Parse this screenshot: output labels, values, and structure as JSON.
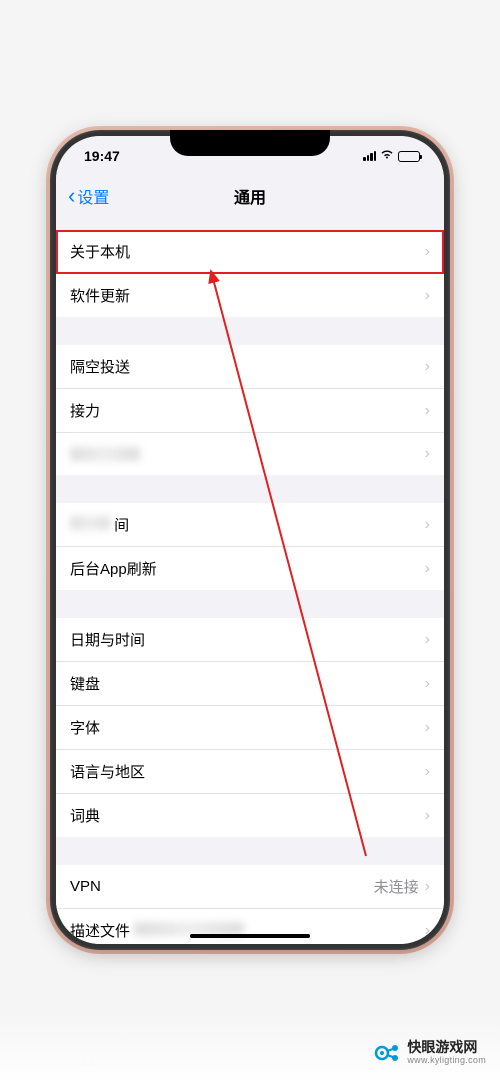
{
  "status": {
    "time": "19:47"
  },
  "nav": {
    "back_label": "设置",
    "title": "通用"
  },
  "groups": [
    {
      "rows": [
        {
          "label": "关于本机",
          "highlighted": true
        },
        {
          "label": "软件更新"
        }
      ]
    },
    {
      "rows": [
        {
          "label": "隔空投送"
        },
        {
          "label": "接力"
        },
        {
          "label": "",
          "blurred": true
        }
      ]
    },
    {
      "rows": [
        {
          "label": "间",
          "blurred_prefix": true
        },
        {
          "label": "后台App刷新"
        }
      ]
    },
    {
      "rows": [
        {
          "label": "日期与时间"
        },
        {
          "label": "键盘"
        },
        {
          "label": "字体"
        },
        {
          "label": "语言与地区"
        },
        {
          "label": "词典"
        }
      ]
    },
    {
      "rows": [
        {
          "label": "VPN",
          "value": "未连接"
        },
        {
          "label": "描述文件",
          "blurred_suffix": true
        }
      ]
    }
  ],
  "watermark": {
    "title": "快眼游戏网",
    "url": "www.kyligting.com"
  },
  "annotation": {
    "arrow_color": "#e02020"
  }
}
